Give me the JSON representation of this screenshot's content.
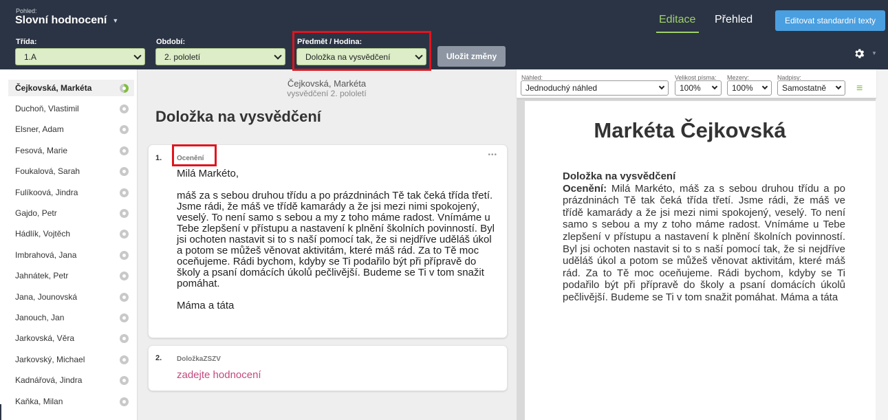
{
  "header": {
    "view_label": "Pohled:",
    "view_title": "Slovní hodnocení",
    "tabs": [
      {
        "label": "Editace",
        "active": true
      },
      {
        "label": "Přehled",
        "active": false
      }
    ],
    "edit_standard_label": "Editovat standardní texty",
    "filters": {
      "trida_label": "Třída:",
      "trida_value": "1.A",
      "obdobi_label": "Období:",
      "obdobi_value": "2. pololetí",
      "predmet_label": "Předmět / Hodina:",
      "predmet_value": "Doložka na vysvědčení"
    },
    "save_label": "Uložit změny"
  },
  "students": [
    {
      "name": "Čejkovská, Markéta",
      "active": true
    },
    {
      "name": "Duchoň, Vlastimil"
    },
    {
      "name": "Elsner, Adam"
    },
    {
      "name": "Fesová, Marie"
    },
    {
      "name": "Foukalová, Sarah"
    },
    {
      "name": "Fulíkoová, Jindra"
    },
    {
      "name": "Gajdo, Petr"
    },
    {
      "name": "Hádlík, Vojtěch"
    },
    {
      "name": "Imbrahová, Jana"
    },
    {
      "name": "Jahnátek, Petr"
    },
    {
      "name": "Jana, Jounovská"
    },
    {
      "name": "Janouch, Jan"
    },
    {
      "name": "Jarkovská, Věra"
    },
    {
      "name": "Jarkovský, Michael"
    },
    {
      "name": "Kadnářová, Jindra"
    },
    {
      "name": "Kaňka, Milan"
    }
  ],
  "editor": {
    "student_name": "Čejkovská, Markéta",
    "period": "vysvědčení 2. pololetí",
    "section_heading": "Doložka na vysvědčení",
    "cards": [
      {
        "number": "1.",
        "title": "Ocenění",
        "menu": "•••",
        "greeting": "Milá Markéto,",
        "body": "máš za s sebou druhou třídu a po prázdninách Tě tak čeká třída třetí. Jsme rádi, že máš ve třídě kamarády a že jsi mezi nimi spokojený, veselý. To není samo s sebou a my z toho máme radost. Vnímáme u Tebe zlepšení v přístupu a nastavení k plnění školních povinností. Byl jsi ochoten nastavit si to s naší pomocí tak, že si nejdříve uděláš úkol a potom se můžeš věnovat aktivitám, které máš rád. Za to Tě moc oceňujeme. Rádi bychom, kdyby se Ti podařilo být při přípravě do školy a psaní domácích úkolů pečlivější. Budeme se Ti v tom snažit pomáhat.",
        "signature": "Máma a táta"
      },
      {
        "number": "2.",
        "title": "DoložkaZSZV",
        "placeholder": "zadejte hodnocení"
      }
    ]
  },
  "preview": {
    "nahled_label": "Náhled:",
    "nahled_value": "Jednoduchý náhled",
    "font_size_label": "Velikost písma:",
    "font_size_value": "100%",
    "spacing_label": "Mezery:",
    "spacing_value": "100%",
    "headings_label": "Nadpisy:",
    "headings_value": "Samostatně",
    "list_icon": "≡",
    "student_name": "Markéta Čejkovská",
    "section_title": "Doložka na vysvědčení",
    "sub_label": "Ocenění:",
    "text": " Milá Markéto, máš za s sebou druhou třídu a po prázdninách Tě tak čeká třída třetí. Jsme rádi, že máš ve třídě kamarády a že jsi mezi nimi spokojený, veselý. To není samo s sebou a my z toho máme radost. Vnímáme u Tebe zlepšení v přístupu a nastavení k plnění školních povinností. Byl jsi ochoten nastavit si to s naší pomocí tak, že si nejdříve uděláš úkol a potom se můžeš věnovat aktivitám, které máš rád. Za to Tě moc oceňujeme. Rádi bychom, kdyby se Ti podařilo být při přípravě do školy a psaní domácích úkolů pečlivější. Budeme se Ti v tom snažit pomáhat. Máma a táta"
  },
  "colors": {
    "topbar": "#2b3444",
    "accent_green": "#9fd16c",
    "select_green": "#dcedc8",
    "button_blue": "#4a9fe0",
    "highlight_red": "#e0141e",
    "placeholder_pink": "#c2487e"
  }
}
